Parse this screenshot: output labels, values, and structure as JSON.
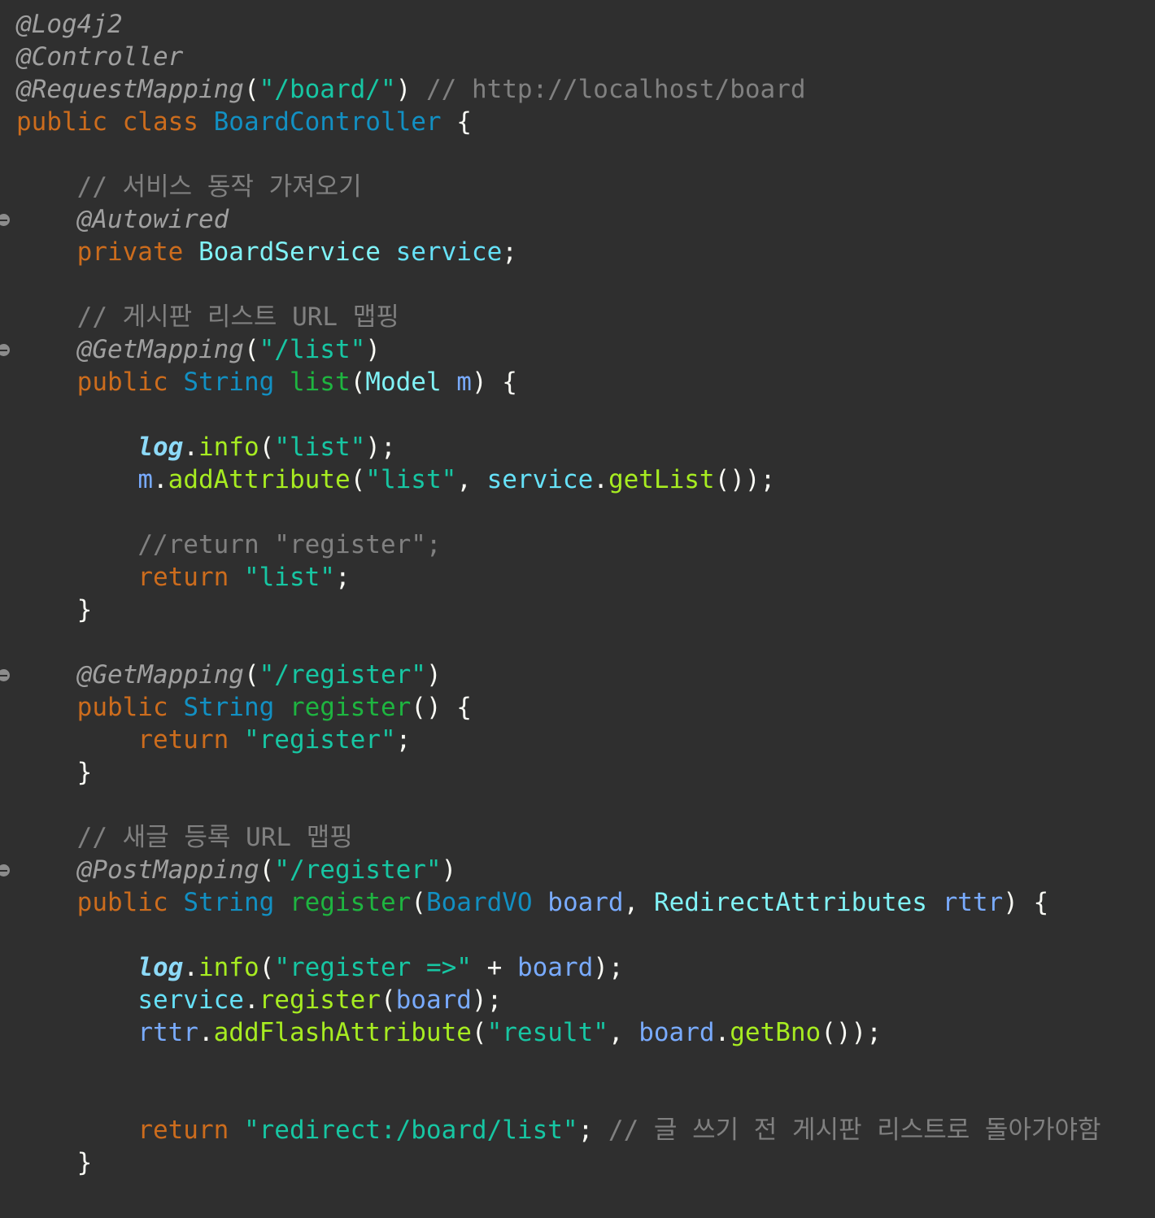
{
  "editor": {
    "language": "Java",
    "theme": {
      "background": "#2f2f2f",
      "keyword": "#cc6c1d",
      "string": "#17c6a3",
      "comment": "#808080",
      "annotation": "#a0a0a0",
      "method_declaration": "#1eb540",
      "type": "#1290c3"
    },
    "lines": [
      {
        "indent": 0,
        "fold": false,
        "tokens": [
          {
            "t": "ann",
            "v": "@Log4j2"
          }
        ]
      },
      {
        "indent": 0,
        "fold": false,
        "tokens": [
          {
            "t": "ann",
            "v": "@Controller"
          }
        ]
      },
      {
        "indent": 0,
        "fold": false,
        "tokens": [
          {
            "t": "ann",
            "v": "@RequestMapping"
          },
          {
            "t": "p",
            "v": "("
          },
          {
            "t": "str",
            "v": "\"/board/\""
          },
          {
            "t": "p",
            "v": ") "
          },
          {
            "t": "cmt",
            "v": "// http://localhost/board"
          }
        ]
      },
      {
        "indent": 0,
        "fold": false,
        "tokens": [
          {
            "t": "kw",
            "v": "public class "
          },
          {
            "t": "cls",
            "v": "BoardController"
          },
          {
            "t": "p",
            "v": " {"
          }
        ]
      },
      {
        "indent": 0,
        "fold": false,
        "tokens": []
      },
      {
        "indent": 1,
        "fold": false,
        "tokens": [
          {
            "t": "cmt",
            "v": "// 서비스 동작 가져오기"
          }
        ]
      },
      {
        "indent": 1,
        "fold": true,
        "tokens": [
          {
            "t": "ann",
            "v": "@Autowired"
          }
        ]
      },
      {
        "indent": 1,
        "fold": false,
        "tokens": [
          {
            "t": "kw",
            "v": "private "
          },
          {
            "t": "typ",
            "v": "BoardService"
          },
          {
            "t": "p",
            "v": " "
          },
          {
            "t": "fld",
            "v": "service"
          },
          {
            "t": "p",
            "v": ";"
          }
        ]
      },
      {
        "indent": 0,
        "fold": false,
        "tokens": []
      },
      {
        "indent": 1,
        "fold": false,
        "tokens": [
          {
            "t": "cmt",
            "v": "// 게시판 리스트 URL 맵핑"
          }
        ]
      },
      {
        "indent": 1,
        "fold": true,
        "tokens": [
          {
            "t": "ann",
            "v": "@GetMapping"
          },
          {
            "t": "p",
            "v": "("
          },
          {
            "t": "str",
            "v": "\"/list\""
          },
          {
            "t": "p",
            "v": ")"
          }
        ]
      },
      {
        "indent": 1,
        "fold": false,
        "tokens": [
          {
            "t": "kw",
            "v": "public "
          },
          {
            "t": "cls",
            "v": "String"
          },
          {
            "t": "p",
            "v": " "
          },
          {
            "t": "mth",
            "v": "list"
          },
          {
            "t": "p",
            "v": "("
          },
          {
            "t": "typ",
            "v": "Model"
          },
          {
            "t": "p",
            "v": " "
          },
          {
            "t": "lv",
            "v": "m"
          },
          {
            "t": "p",
            "v": ") {"
          }
        ]
      },
      {
        "indent": 0,
        "fold": false,
        "tokens": []
      },
      {
        "indent": 2,
        "fold": false,
        "tokens": [
          {
            "t": "sf",
            "v": "log"
          },
          {
            "t": "p",
            "v": "."
          },
          {
            "t": "call",
            "v": "info"
          },
          {
            "t": "p",
            "v": "("
          },
          {
            "t": "str",
            "v": "\"list\""
          },
          {
            "t": "p",
            "v": ");"
          }
        ]
      },
      {
        "indent": 2,
        "fold": false,
        "tokens": [
          {
            "t": "lv",
            "v": "m"
          },
          {
            "t": "p",
            "v": "."
          },
          {
            "t": "call",
            "v": "addAttribute"
          },
          {
            "t": "p",
            "v": "("
          },
          {
            "t": "str",
            "v": "\"list\""
          },
          {
            "t": "p",
            "v": ", "
          },
          {
            "t": "fld",
            "v": "service"
          },
          {
            "t": "p",
            "v": "."
          },
          {
            "t": "call",
            "v": "getList"
          },
          {
            "t": "p",
            "v": "());"
          }
        ]
      },
      {
        "indent": 0,
        "fold": false,
        "tokens": []
      },
      {
        "indent": 2,
        "fold": false,
        "tokens": [
          {
            "t": "cmt",
            "v": "//return \"register\";"
          }
        ]
      },
      {
        "indent": 2,
        "fold": false,
        "tokens": [
          {
            "t": "kw",
            "v": "return "
          },
          {
            "t": "str",
            "v": "\"list\""
          },
          {
            "t": "p",
            "v": ";"
          }
        ]
      },
      {
        "indent": 1,
        "fold": false,
        "tokens": [
          {
            "t": "p",
            "v": "}"
          }
        ]
      },
      {
        "indent": 0,
        "fold": false,
        "tokens": []
      },
      {
        "indent": 1,
        "fold": true,
        "tokens": [
          {
            "t": "ann",
            "v": "@GetMapping"
          },
          {
            "t": "p",
            "v": "("
          },
          {
            "t": "str",
            "v": "\"/register\""
          },
          {
            "t": "p",
            "v": ")"
          }
        ]
      },
      {
        "indent": 1,
        "fold": false,
        "tokens": [
          {
            "t": "kw",
            "v": "public "
          },
          {
            "t": "cls",
            "v": "String"
          },
          {
            "t": "p",
            "v": " "
          },
          {
            "t": "mth",
            "v": "register"
          },
          {
            "t": "p",
            "v": "() {"
          }
        ]
      },
      {
        "indent": 2,
        "fold": false,
        "tokens": [
          {
            "t": "kw",
            "v": "return "
          },
          {
            "t": "str",
            "v": "\"register\""
          },
          {
            "t": "p",
            "v": ";"
          }
        ]
      },
      {
        "indent": 1,
        "fold": false,
        "tokens": [
          {
            "t": "p",
            "v": "}"
          }
        ]
      },
      {
        "indent": 0,
        "fold": false,
        "tokens": []
      },
      {
        "indent": 1,
        "fold": false,
        "tokens": [
          {
            "t": "cmt",
            "v": "// 새글 등록 URL 맵핑"
          }
        ]
      },
      {
        "indent": 1,
        "fold": true,
        "tokens": [
          {
            "t": "ann",
            "v": "@PostMapping"
          },
          {
            "t": "p",
            "v": "("
          },
          {
            "t": "str",
            "v": "\"/register\""
          },
          {
            "t": "p",
            "v": ")"
          }
        ]
      },
      {
        "indent": 1,
        "fold": false,
        "tokens": [
          {
            "t": "kw",
            "v": "public "
          },
          {
            "t": "cls",
            "v": "String"
          },
          {
            "t": "p",
            "v": " "
          },
          {
            "t": "mth",
            "v": "register"
          },
          {
            "t": "p",
            "v": "("
          },
          {
            "t": "cls",
            "v": "BoardVO"
          },
          {
            "t": "p",
            "v": " "
          },
          {
            "t": "lv",
            "v": "board"
          },
          {
            "t": "p",
            "v": ", "
          },
          {
            "t": "typ",
            "v": "RedirectAttributes"
          },
          {
            "t": "p",
            "v": " "
          },
          {
            "t": "lv",
            "v": "rttr"
          },
          {
            "t": "p",
            "v": ") {"
          }
        ]
      },
      {
        "indent": 0,
        "fold": false,
        "tokens": []
      },
      {
        "indent": 2,
        "fold": false,
        "tokens": [
          {
            "t": "sf",
            "v": "log"
          },
          {
            "t": "p",
            "v": "."
          },
          {
            "t": "call",
            "v": "info"
          },
          {
            "t": "p",
            "v": "("
          },
          {
            "t": "str",
            "v": "\"register =>\""
          },
          {
            "t": "p",
            "v": " + "
          },
          {
            "t": "lv",
            "v": "board"
          },
          {
            "t": "p",
            "v": ");"
          }
        ]
      },
      {
        "indent": 2,
        "fold": false,
        "tokens": [
          {
            "t": "fld",
            "v": "service"
          },
          {
            "t": "p",
            "v": "."
          },
          {
            "t": "call",
            "v": "register"
          },
          {
            "t": "p",
            "v": "("
          },
          {
            "t": "lv",
            "v": "board"
          },
          {
            "t": "p",
            "v": ");"
          }
        ]
      },
      {
        "indent": 2,
        "fold": false,
        "tokens": [
          {
            "t": "lv",
            "v": "rttr"
          },
          {
            "t": "p",
            "v": "."
          },
          {
            "t": "call",
            "v": "addFlashAttribute"
          },
          {
            "t": "p",
            "v": "("
          },
          {
            "t": "str",
            "v": "\"result\""
          },
          {
            "t": "p",
            "v": ", "
          },
          {
            "t": "lv",
            "v": "board"
          },
          {
            "t": "p",
            "v": "."
          },
          {
            "t": "ec",
            "v": "getBno"
          },
          {
            "t": "p",
            "v": "());"
          }
        ]
      },
      {
        "indent": 0,
        "fold": false,
        "tokens": []
      },
      {
        "indent": 0,
        "fold": false,
        "tokens": []
      },
      {
        "indent": 2,
        "fold": false,
        "tokens": [
          {
            "t": "kw",
            "v": "return "
          },
          {
            "t": "str",
            "v": "\"redirect:/board/list\""
          },
          {
            "t": "p",
            "v": "; "
          },
          {
            "t": "cmt",
            "v": "// 글 쓰기 전 게시판 리스트로 돌아가야함"
          }
        ]
      },
      {
        "indent": 1,
        "fold": false,
        "tokens": [
          {
            "t": "p",
            "v": "}"
          }
        ]
      }
    ]
  }
}
